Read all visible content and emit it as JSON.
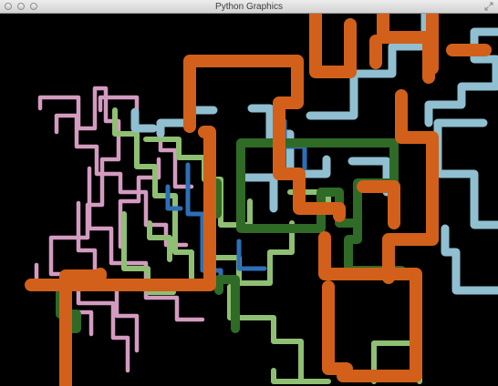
{
  "window": {
    "title": "Python Graphics"
  },
  "icons": {
    "close": "close-icon",
    "minimize": "minimize-icon",
    "zoom": "zoom-icon",
    "fullscreen": "fullscreen-arrows-icon"
  },
  "scene": {
    "background": "#000000",
    "pipe_colors": {
      "orange": "#d2601a",
      "green": "#2f6a26",
      "light_green": "#8fbf72",
      "light_blue": "#8fbfd0",
      "pink": "#d39bc0",
      "blue": "#2d6fb6"
    }
  }
}
